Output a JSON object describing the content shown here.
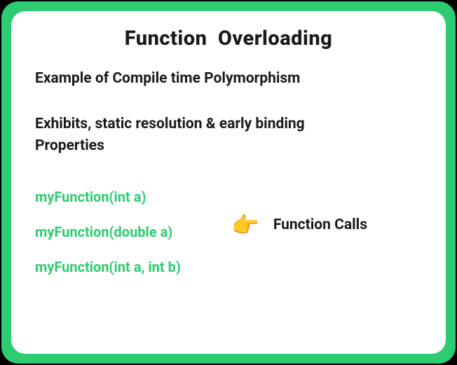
{
  "title": "Function  Overloading",
  "description1": "Example of Compile time Polymorphism",
  "description2_line1": "Exhibits, static resolution & early binding",
  "description2_line2": " Properties",
  "functions": {
    "f1": "myFunction(int a)",
    "f2": "myFunction(double a)",
    "f3": "myFunction(int a, int b)"
  },
  "pointer": {
    "icon": "👉",
    "label": "Function Calls"
  }
}
